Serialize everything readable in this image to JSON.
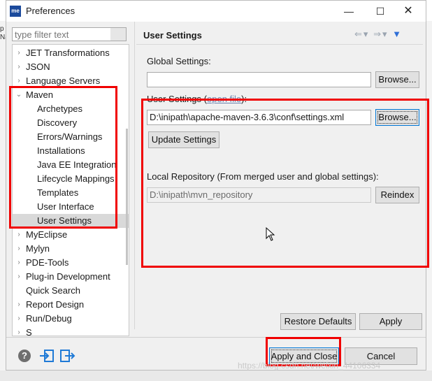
{
  "window": {
    "app_icon_text": "me",
    "title": "Preferences",
    "minimize": "—",
    "maximize": "☐",
    "close": "✕"
  },
  "filter": {
    "placeholder": "type filter text",
    "value": ""
  },
  "tree": {
    "items": [
      {
        "label": "JET Transformations",
        "arrow": "›"
      },
      {
        "label": "JSON",
        "arrow": "›"
      },
      {
        "label": "Language Servers",
        "arrow": "›"
      },
      {
        "label": "Maven",
        "arrow": "⌄",
        "expanded": true
      },
      {
        "label": "Archetypes"
      },
      {
        "label": "Discovery"
      },
      {
        "label": "Errors/Warnings"
      },
      {
        "label": "Installations"
      },
      {
        "label": "Java EE Integration"
      },
      {
        "label": "Lifecycle Mappings"
      },
      {
        "label": "Templates"
      },
      {
        "label": "User Interface"
      },
      {
        "label": "User Settings",
        "selected": true
      },
      {
        "label": "MyEclipse",
        "arrow": "›"
      },
      {
        "label": "Mylyn",
        "arrow": "›"
      },
      {
        "label": "PDE-Tools",
        "arrow": "›"
      },
      {
        "label": "Plug-in Development",
        "arrow": "›"
      },
      {
        "label": "Quick Search"
      },
      {
        "label": "Report Design",
        "arrow": "›"
      },
      {
        "label": "Run/Debug",
        "arrow": "›"
      },
      {
        "label": "S",
        "arrow": "›"
      }
    ]
  },
  "page": {
    "title": "User Settings",
    "nav": {
      "back": "⇐",
      "back_menu": "▾",
      "forward": "⇒",
      "forward_menu": "▾",
      "view_menu": "▼"
    },
    "global_settings_label": "Global Settings:",
    "global_settings_value": "",
    "browse_label": "Browse...",
    "user_settings_label": "User Settings",
    "open_file_link": "open file",
    "user_settings_value": "D:\\inipath\\apache-maven-3.6.3\\conf\\settings.xml",
    "update_settings_label": "Update Settings",
    "local_repo_label": "Local Repository (From merged user and global settings):",
    "local_repo_value": "D:\\inipath\\mvn_repository",
    "reindex_label": "Reindex",
    "restore_defaults_label": "Restore Defaults",
    "apply_label": "Apply"
  },
  "footer": {
    "help_icon_text": "?",
    "apply_close_label": "Apply and Close",
    "cancel_label": "Cancel"
  },
  "watermark": "https://blog.csdn.net/weixin_44106334",
  "colors": {
    "highlight_box": "#f00000",
    "selection": "#d9d9d9",
    "link": "#6d84b0",
    "focus": "#0078d7"
  }
}
